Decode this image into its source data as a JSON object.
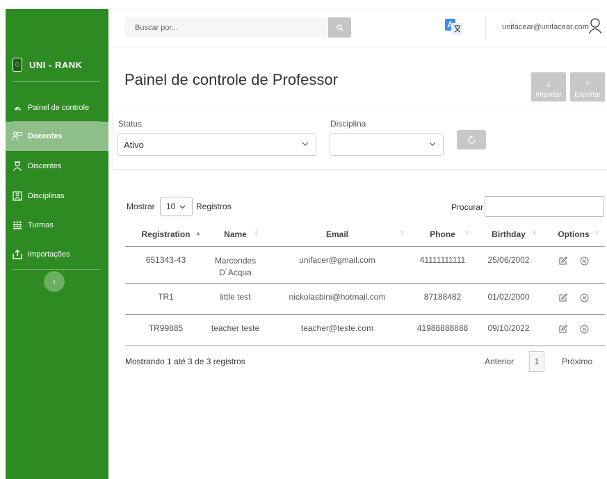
{
  "brand": {
    "name": "UNI - RANK"
  },
  "nav": {
    "painel": "Painel de controle",
    "docentes": "Docentes",
    "discentes": "Discentes",
    "disciplinas": "Disciplinas",
    "turmas": "Turmas",
    "importacoes": "Importações"
  },
  "topbar": {
    "search_placeholder": "Buscar por...",
    "user_email": "unifacear@unifacear.com"
  },
  "page": {
    "title": "Painel de controle de Professor",
    "importar": "Importar",
    "exportar": "Exportar"
  },
  "filters": {
    "status_label": "Status",
    "status_value": "Ativo",
    "disciplina_label": "Disciplina",
    "disciplina_value": ""
  },
  "table": {
    "show_prefix": "Mostrar",
    "page_length": "10",
    "show_suffix": "Registros",
    "search_label": "Procurar",
    "columns": [
      "Registration",
      "Name",
      "Email",
      "Phone",
      "Birthday",
      "Options"
    ],
    "rows": [
      {
        "registration": "651343-43",
        "name": "Marcondes D´Acqua",
        "email": "unifacer@gmail.com",
        "phone": "41111111111",
        "birthday": "25/06/2002"
      },
      {
        "registration": "TR1",
        "name": "little test",
        "email": "nickolasbini@hotmail.com",
        "phone": "87188482",
        "birthday": "01/02/2000"
      },
      {
        "registration": "TR99885",
        "name": "teacher teste",
        "email": "teacher@teste.com",
        "phone": "41988888888",
        "birthday": "09/10/2022"
      }
    ],
    "info": "Mostrando 1 até 3 de 3 registros",
    "prev": "Anterior",
    "current_page": "1",
    "next": "Próximo"
  },
  "colors": {
    "sidebar": "#2e8b23",
    "active_item": "#8fbf88",
    "button_gray": "#c8c8c8"
  }
}
